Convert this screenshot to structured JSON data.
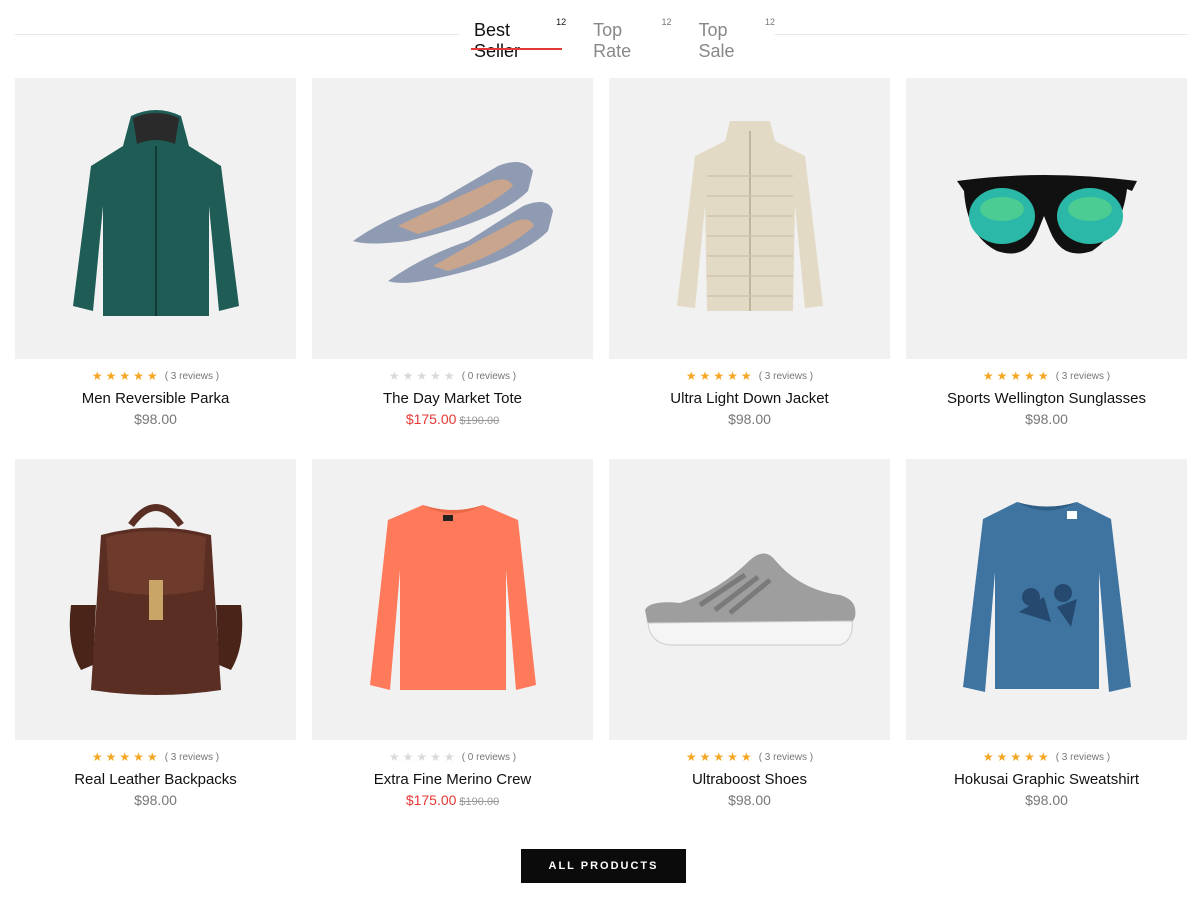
{
  "tabs": [
    {
      "label": "Best Seller",
      "count": "12",
      "active": true
    },
    {
      "label": "Top Rate",
      "count": "12",
      "active": false
    },
    {
      "label": "Top Sale",
      "count": "12",
      "active": false
    }
  ],
  "products": [
    {
      "name": "Men Reversible Parka",
      "rating": 5,
      "reviews": "( 3 reviews )",
      "price": "$98.00",
      "sale_price": "",
      "old_price": "",
      "image_icon": "parka-icon",
      "color": "#1f5c55"
    },
    {
      "name": "The Day Market Tote",
      "rating": 0,
      "reviews": "( 0 reviews )",
      "price": "",
      "sale_price": "$175.00",
      "old_price": "$190.00",
      "image_icon": "flats-shoes-icon",
      "color": "#8f9bb3"
    },
    {
      "name": "Ultra Light Down Jacket",
      "rating": 5,
      "reviews": "( 3 reviews )",
      "price": "$98.00",
      "sale_price": "",
      "old_price": "",
      "image_icon": "down-jacket-icon",
      "color": "#e3dac6"
    },
    {
      "name": "Sports Wellington Sunglasses",
      "rating": 5,
      "reviews": "( 3 reviews )",
      "price": "$98.00",
      "sale_price": "",
      "old_price": "",
      "image_icon": "sunglasses-icon",
      "color": "#111111"
    },
    {
      "name": "Real Leather Backpacks",
      "rating": 5,
      "reviews": "( 3 reviews )",
      "price": "$98.00",
      "sale_price": "",
      "old_price": "",
      "image_icon": "backpack-icon",
      "color": "#5a2e22"
    },
    {
      "name": "Extra Fine Merino Crew",
      "rating": 0,
      "reviews": "( 0 reviews )",
      "price": "",
      "sale_price": "$175.00",
      "old_price": "$190.00",
      "image_icon": "sweater-icon",
      "color": "#ff7a5a"
    },
    {
      "name": "Ultraboost Shoes",
      "rating": 5,
      "reviews": "( 3 reviews )",
      "price": "$98.00",
      "sale_price": "",
      "old_price": "",
      "image_icon": "sneaker-icon",
      "color": "#9e9e9e"
    },
    {
      "name": "Hokusai Graphic Sweatshirt",
      "rating": 5,
      "reviews": "( 3 reviews )",
      "price": "$98.00",
      "sale_price": "",
      "old_price": "",
      "image_icon": "sweatshirt-icon",
      "color": "#3f74a0"
    }
  ],
  "cta": {
    "label": "ALL PRODUCTS"
  },
  "colors": {
    "accent": "#e53935",
    "star": "#f5a623",
    "star_off": "#d9d9d9",
    "thumb_bg": "#f1f1f2"
  }
}
